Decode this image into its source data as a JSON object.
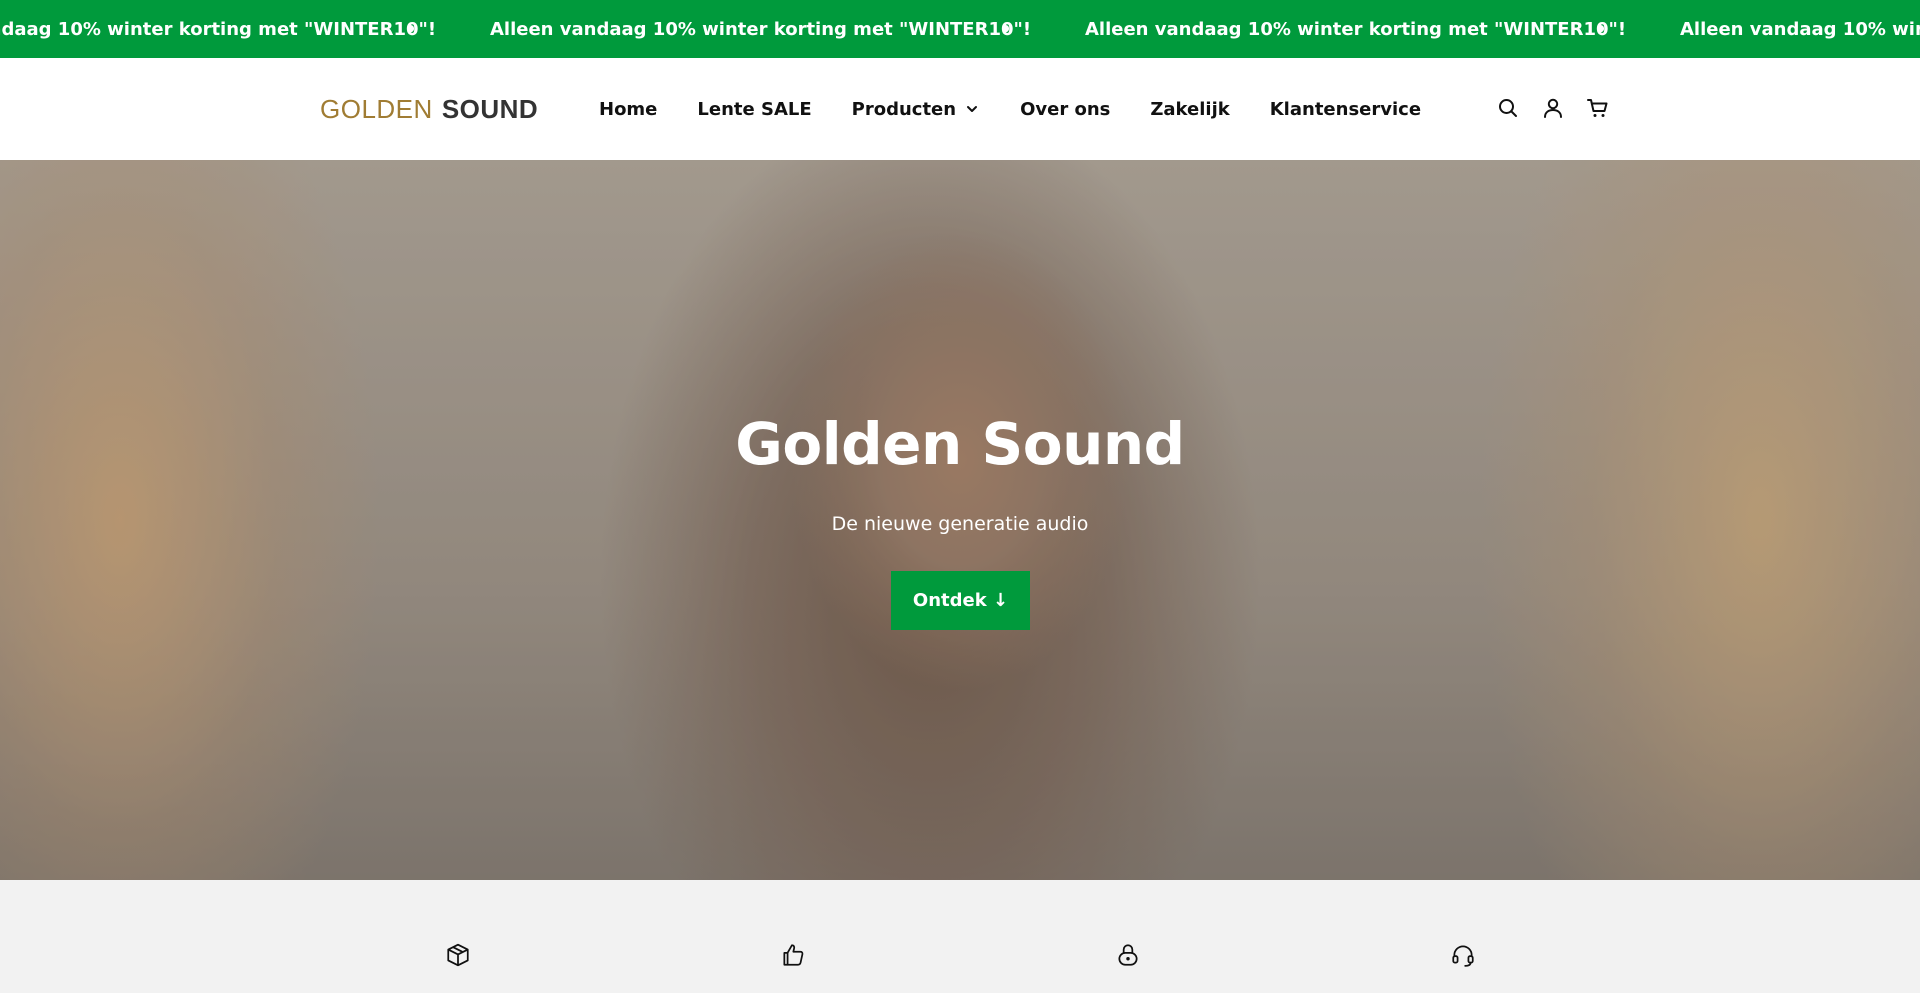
{
  "announcement": {
    "message": "Alleen vandaag 10% winter korting met \"WINTER10\"!",
    "separator": "•",
    "background_color": "#009a3c"
  },
  "header": {
    "logo": {
      "part1": "GOLDEN",
      "part2": "SOUND"
    },
    "nav": [
      {
        "label": "Home"
      },
      {
        "label": "Lente SALE"
      },
      {
        "label": "Producten",
        "has_dropdown": true
      },
      {
        "label": "Over ons"
      },
      {
        "label": "Zakelijk"
      },
      {
        "label": "Klantenservice"
      }
    ],
    "icons": [
      "search-icon",
      "account-icon",
      "cart-icon"
    ]
  },
  "hero": {
    "title": "Golden Sound",
    "subtitle": "De nieuwe generatie audio",
    "cta_label": "Ontdek ↓",
    "cta_color": "#009a3c"
  },
  "features": {
    "icons": [
      "package-icon",
      "thumbs-up-icon",
      "lock-icon",
      "headset-icon"
    ]
  }
}
